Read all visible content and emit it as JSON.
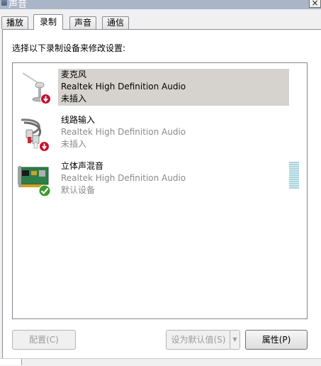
{
  "window": {
    "title": "声音",
    "close_label": "×"
  },
  "tabs": [
    {
      "label": "播放"
    },
    {
      "label": "录制"
    },
    {
      "label": "声音"
    },
    {
      "label": "通信"
    }
  ],
  "instruction": "选择以下录制设备来修改设置:",
  "devices": [
    {
      "name": "麦克风",
      "driver": "Realtek High Definition Audio",
      "status": "未插入",
      "icon": "microphone-icon",
      "badge": "unplugged-badge-icon"
    },
    {
      "name": "线路输入",
      "driver": "Realtek High Definition Audio",
      "status": "未插入",
      "icon": "line-in-cable-icon",
      "badge": "unplugged-badge-icon"
    },
    {
      "name": "立体声混音",
      "driver": "Realtek High Definition Audio",
      "status": "默认设备",
      "icon": "sound-card-icon",
      "badge": "default-check-icon"
    }
  ],
  "buttons": {
    "configure": "配置(C)",
    "set_default": "设为默认值(S)",
    "set_default_arrow": "▼",
    "properties": "属性(P)"
  },
  "colors": {
    "selection": "#d6d3ce",
    "unplugged_badge": "#c8102e",
    "default_badge": "#3a9a2a",
    "level_meter": "#a9d4df"
  }
}
